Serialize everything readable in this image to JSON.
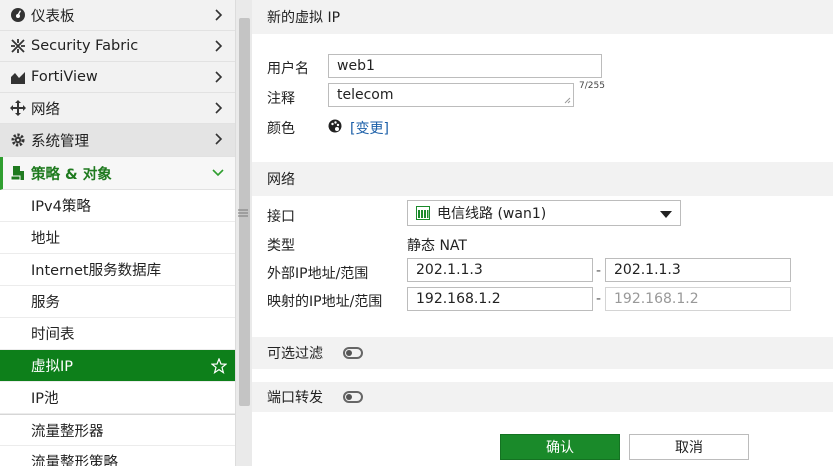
{
  "sidebar": {
    "items": [
      {
        "label": "仪表板",
        "icon": "dashboard-icon"
      },
      {
        "label": "Security Fabric",
        "icon": "fabric-icon"
      },
      {
        "label": "FortiView",
        "icon": "chart-icon"
      },
      {
        "label": "网络",
        "icon": "network-move-icon"
      },
      {
        "label": "系统管理",
        "icon": "gear-icon"
      }
    ],
    "group": {
      "label": "策略 & 对象",
      "icon": "policy-icon"
    },
    "subitems": [
      {
        "label": "IPv4策略"
      },
      {
        "label": "地址"
      },
      {
        "label": "Internet服务数据库"
      },
      {
        "label": "服务"
      },
      {
        "label": "时间表"
      },
      {
        "label": "虚拟IP"
      },
      {
        "label": "IP池"
      },
      {
        "label": "流量整形器"
      },
      {
        "label": "流量整形策略"
      }
    ]
  },
  "form": {
    "title": "新的虚拟 IP",
    "name_label": "用户名",
    "name_value": "web1",
    "comment_label": "注释",
    "comment_value": "telecom",
    "comment_counter": "7/255",
    "color_label": "颜色",
    "color_change_link": "[变更]",
    "network_section": "网络",
    "interface_label": "接口",
    "interface_value": "电信线路 (wan1)",
    "type_label": "类型",
    "type_value": "静态 NAT",
    "external_ip_label": "外部IP地址/范围",
    "external_ip_start": "202.1.1.3",
    "external_ip_end": "202.1.1.3",
    "mapped_ip_label": "映射的IP地址/范围",
    "mapped_ip_start": "192.168.1.2",
    "mapped_ip_end": "192.168.1.2",
    "dash": "-",
    "optional_filter_label": "可选过滤",
    "optional_filter_on": false,
    "port_forward_label": "端口转发",
    "port_forward_on": false,
    "ok_button": "确认",
    "cancel_button": "取消"
  },
  "colors": {
    "accent_green": "#0d7f1a",
    "group_green": "#1f7a1f",
    "link_blue": "#1b5fa8"
  }
}
